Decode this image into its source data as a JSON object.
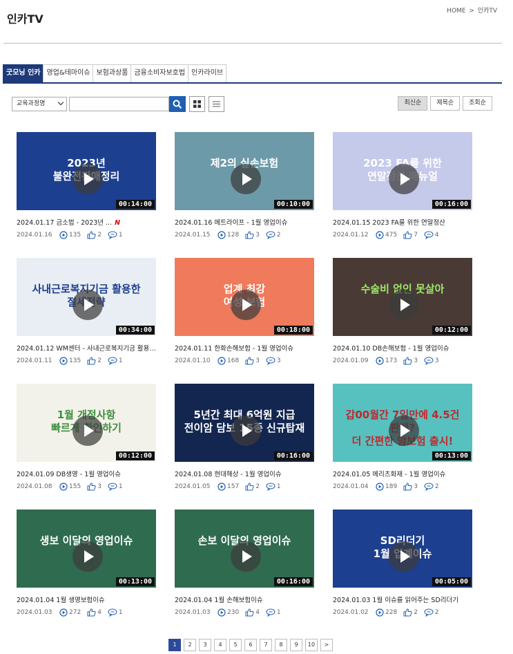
{
  "header": {
    "title": "인카TV",
    "breadcrumb": {
      "home": "HOME",
      "separator": ">",
      "current": "인카TV"
    }
  },
  "tabs": [
    {
      "label": "굿모닝 인카",
      "active": true
    },
    {
      "label": "영업&테마이슈",
      "active": false
    },
    {
      "label": "보험과상품",
      "active": false
    },
    {
      "label": "금융소비자보호법",
      "active": false
    },
    {
      "label": "인카라이브",
      "active": false
    }
  ],
  "toolbar": {
    "select_value": "교육과정명",
    "search_value": "",
    "sort": [
      {
        "label": "최신순",
        "active": true
      },
      {
        "label": "제목순",
        "active": false
      },
      {
        "label": "조회순",
        "active": false
      }
    ]
  },
  "videos": [
    {
      "title": "2024.01.17 금소법 - 2023년 ...",
      "new": "N",
      "date": "2024.01.16",
      "views": "135",
      "likes": "2",
      "comments": "1",
      "duration": "00:14:00",
      "thumb_text": "2023년\n불완전판매정리",
      "thumb_bg": "#1d3f8f",
      "thumb_color": "#ffffff"
    },
    {
      "title": "2024.01.16 메트라이프 - 1월 영업이슈",
      "new": "",
      "date": "2024.01.15",
      "views": "128",
      "likes": "3",
      "comments": "2",
      "duration": "00:10:00",
      "thumb_text": "제2의 실손보험",
      "thumb_bg": "#6d9aa8",
      "thumb_color": "#ffffff"
    },
    {
      "title": "2024.01.15 2023 FA를 위한 연말정산",
      "new": "",
      "date": "2024.01.12",
      "views": "475",
      "likes": "7",
      "comments": "4",
      "duration": "00:16:00",
      "thumb_text": "2023 FA를 위한\n연말정산 매뉴얼",
      "thumb_bg": "#c5c9ea",
      "thumb_color": "#ffffff"
    },
    {
      "title": "2024.01.12 WM센터 - 사내근로복지기금 활용한 절...",
      "new": "",
      "date": "2024.01.11",
      "views": "135",
      "likes": "2",
      "comments": "1",
      "duration": "00:34:00",
      "thumb_text": "사내근로복지기금 활용한\n절세전략",
      "thumb_bg": "#e9eef5",
      "thumb_color": "#1d3f8f"
    },
    {
      "title": "2024.01.11 한화손해보험 - 1월 영업이슈",
      "new": "",
      "date": "2024.01.10",
      "views": "168",
      "likes": "3",
      "comments": "3",
      "duration": "00:18:00",
      "thumb_text": "업계 최강\n여성 보험",
      "thumb_bg": "#ef7a5c",
      "thumb_color": "#ffffff"
    },
    {
      "title": "2024.01.10 DB손해보험 - 1월 영업이슈",
      "new": "",
      "date": "2024.01.09",
      "views": "173",
      "likes": "3",
      "comments": "3",
      "duration": "00:12:00",
      "thumb_text": "수술비 없인 못살아",
      "thumb_bg": "#4a3a35",
      "thumb_color": "#9fe86a"
    },
    {
      "title": "2024.01.09 DB생명 - 1월 영업이슈",
      "new": "",
      "date": "2024.01.08",
      "views": "155",
      "likes": "3",
      "comments": "1",
      "duration": "00:12:00",
      "thumb_text": "1월 개정사항\n빠르게 확인하기",
      "thumb_bg": "#f2f2ea",
      "thumb_color": "#3e8f3e"
    },
    {
      "title": "2024.01.08 현대해상 - 1월 영업이슈",
      "new": "",
      "date": "2024.01.05",
      "views": "157",
      "likes": "2",
      "comments": "1",
      "duration": "00:16:00",
      "thumb_text": "5년간 최대 6억원 지급\n전이암 담보 15종 신규탑재",
      "thumb_bg": "#12264f",
      "thumb_color": "#ffffff"
    },
    {
      "title": "2024.01.05 메리츠화재 - 1월 영업이슈",
      "new": "",
      "date": "2024.01.04",
      "views": "189",
      "likes": "3",
      "comments": "2",
      "duration": "00:13:00",
      "thumb_text": "갑00월간 7일만에 4.5건 판매?\n더 간편한 암보험 출시!",
      "thumb_bg": "#57c1bf",
      "thumb_color": "#c0272d"
    },
    {
      "title": "2024.01.04 1월 생명보험이슈",
      "new": "",
      "date": "2024.01.03",
      "views": "272",
      "likes": "4",
      "comments": "1",
      "duration": "00:13:00",
      "thumb_text": "생보 이달의 영업이슈",
      "thumb_bg": "#2f6b4f",
      "thumb_color": "#ffffff"
    },
    {
      "title": "2024.01.04 1월 손해보험이슈",
      "new": "",
      "date": "2024.01.03",
      "views": "230",
      "likes": "4",
      "comments": "1",
      "duration": "00:16:00",
      "thumb_text": "손보 이달의 영업이슈",
      "thumb_bg": "#2f6b4f",
      "thumb_color": "#ffffff"
    },
    {
      "title": "2024.01.03 1월 이슈를 읽어주는 SD리더기",
      "new": "",
      "date": "2024.01.02",
      "views": "228",
      "likes": "2",
      "comments": "2",
      "duration": "00:05:00",
      "thumb_text": "SD리더기\n1월 업계이슈",
      "thumb_bg": "#1d3f8f",
      "thumb_color": "#ffffff"
    }
  ],
  "pagination": {
    "pages": [
      "1",
      "2",
      "3",
      "4",
      "5",
      "6",
      "7",
      "8",
      "9",
      "10"
    ],
    "current": "1",
    "next": ">"
  }
}
